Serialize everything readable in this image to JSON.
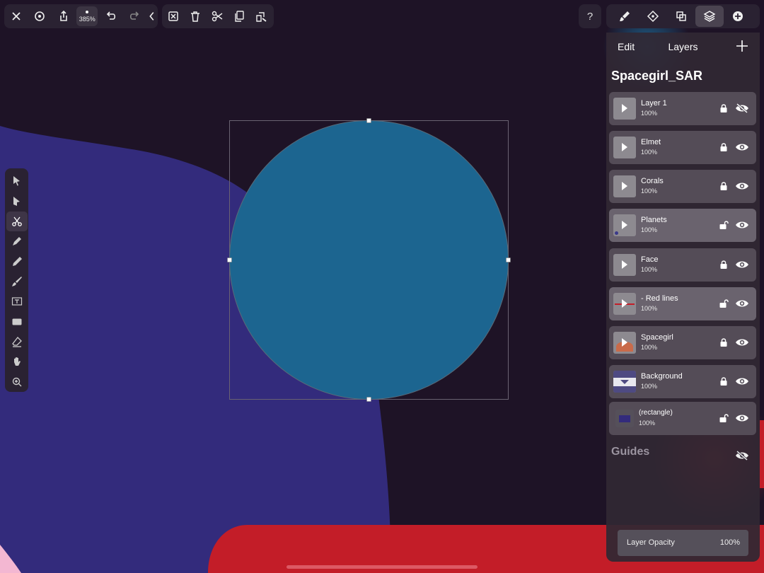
{
  "toolbar": {
    "zoom": "385%",
    "left_icons": [
      "close-icon",
      "settings-icon",
      "share-icon",
      "undo-icon",
      "redo-icon",
      "collapse-icon"
    ],
    "edit_icons": [
      "deselect-icon",
      "trash-icon",
      "scissors-icon",
      "copy-icon",
      "paste-icon"
    ],
    "help": "?"
  },
  "studio_tabs": [
    "brush-studio-icon",
    "navigator-icon",
    "transform-studio-icon",
    "layers-studio-icon",
    "add-studio-icon"
  ],
  "tools": [
    "move-icon",
    "node-icon",
    "scissors-tool-icon",
    "pen-icon",
    "pencil-icon",
    "brush-icon",
    "text-icon",
    "rectangle-icon",
    "eraser-icon",
    "hand-icon",
    "zoom-icon"
  ],
  "panel": {
    "edit_label": "Edit",
    "title": "Layers",
    "document_name": "Spacegirl_SAR",
    "layers": [
      {
        "name": "Layer 1",
        "opacity": "100%",
        "locked": true,
        "visible": false,
        "highlight": false
      },
      {
        "name": "Elmet",
        "opacity": "100%",
        "locked": true,
        "visible": true,
        "highlight": false
      },
      {
        "name": "Corals",
        "opacity": "100%",
        "locked": true,
        "visible": true,
        "highlight": false
      },
      {
        "name": "Planets",
        "opacity": "100%",
        "locked": false,
        "visible": true,
        "highlight": true
      },
      {
        "name": "Face",
        "opacity": "100%",
        "locked": true,
        "visible": true,
        "highlight": false
      },
      {
        "name": "- Red lines",
        "opacity": "100%",
        "locked": false,
        "visible": true,
        "highlight": true
      },
      {
        "name": "Spacegirl",
        "opacity": "100%",
        "locked": true,
        "visible": true,
        "highlight": false
      },
      {
        "name": "Background",
        "opacity": "100%",
        "locked": true,
        "visible": true,
        "highlight": false
      },
      {
        "name": "(rectangle)",
        "opacity": "100%",
        "locked": false,
        "visible": true,
        "highlight": false
      }
    ],
    "guides_label": "Guides",
    "opacity_label": "Layer Opacity",
    "opacity_value": "100%"
  },
  "colors": {
    "canvas_bg": "#1e1326",
    "blue_shape": "#332b7c",
    "selected_circle": "#1c6590",
    "red_shape": "#c31d28"
  }
}
